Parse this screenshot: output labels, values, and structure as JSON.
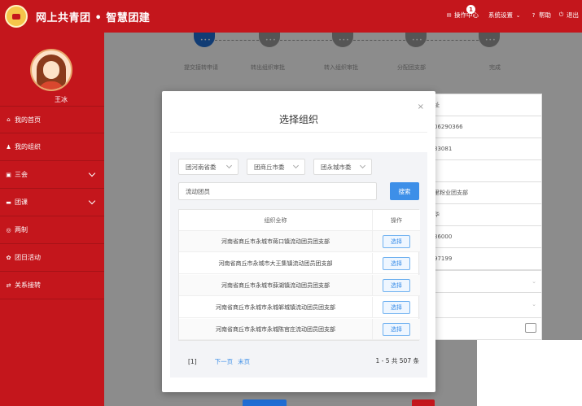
{
  "header": {
    "title": "网上共青团 • 智慧团建",
    "messages_label": "操作中心",
    "messages_badge": "1",
    "settings_label": "系统设置",
    "help_label": "帮助",
    "logout_label": "退出",
    "bg_color": "#c4161c"
  },
  "sidebar": {
    "username": "王冰",
    "items": [
      {
        "label": "我的首页",
        "icon": "home-icon",
        "glyph": "⌂",
        "expandable": false
      },
      {
        "label": "我的组织",
        "icon": "org-icon",
        "glyph": "♟",
        "expandable": false
      },
      {
        "label": "三会",
        "icon": "meeting-icon",
        "glyph": "▣",
        "expandable": true
      },
      {
        "label": "团课",
        "icon": "folder-icon",
        "glyph": "▬",
        "expandable": true
      },
      {
        "label": "两制",
        "icon": "target-icon",
        "glyph": "◎",
        "expandable": false
      },
      {
        "label": "团日活动",
        "icon": "activity-icon",
        "glyph": "✿",
        "expandable": false
      },
      {
        "label": "关系接转",
        "icon": "transfer-icon",
        "glyph": "⇄",
        "expandable": false
      }
    ]
  },
  "steps": [
    {
      "label": "提交接转申请",
      "dot": "•••",
      "active": true
    },
    {
      "label": "转出组织审批",
      "dot": "•••",
      "active": false
    },
    {
      "label": "转入组织审批",
      "dot": "•••",
      "active": false
    },
    {
      "label": "分配团支部",
      "dot": "•••",
      "active": false
    },
    {
      "label": "完成",
      "dot": "•••",
      "active": false
    }
  ],
  "behind_fragments": [
    "址",
    "06290366",
    "33081",
    "",
    "里粉业团支部",
    "华",
    "36000",
    "97199"
  ],
  "modal": {
    "title": "选择组织",
    "close_glyph": "×",
    "selects": [
      "团河南省委",
      "团商丘市委",
      "团永城市委"
    ],
    "search_value": "流动团员",
    "search_button": "搜索",
    "table": {
      "col_name": "组织全称",
      "col_action": "操作",
      "rows": [
        "河南省商丘市永城市蒋口镇流动团员团支部",
        "河南省商丘市永城市大王集镇流动团员团支部",
        "河南省商丘市永城市薛湖镇流动团员团支部",
        "河南省商丘市永城市永城郸城镇流动团员团支部",
        "河南省商丘市永城市永城陈官庄流动团员团支部"
      ],
      "select_label": "选择"
    },
    "pager": {
      "current": "[1]",
      "next": "下一页",
      "last": "末页",
      "info": "1 - 5  共 507 条"
    }
  }
}
